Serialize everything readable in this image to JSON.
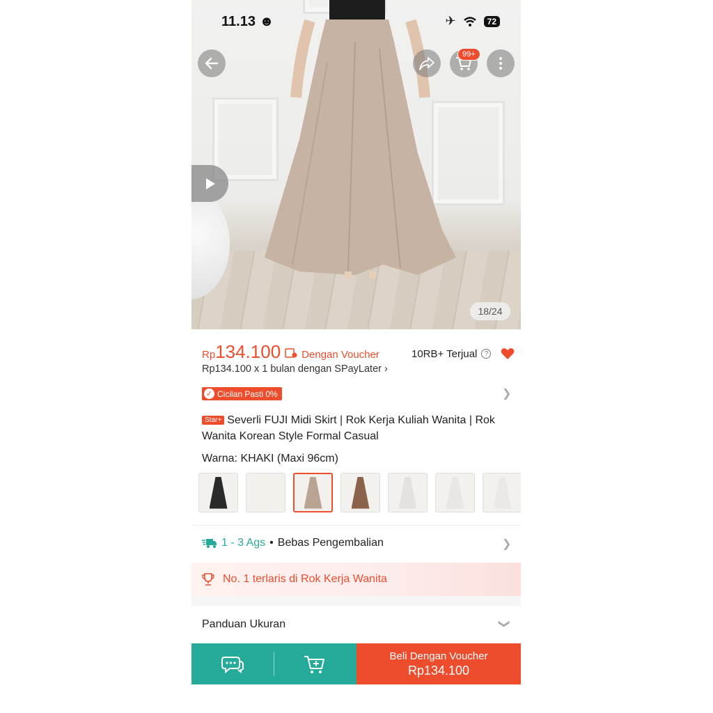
{
  "status_bar": {
    "time": "11.13",
    "battery": "72"
  },
  "gallery": {
    "counter": "18/24"
  },
  "cart": {
    "badge": "99+"
  },
  "price": {
    "currency": "Rp",
    "amount": "134.100",
    "voucher_label": "Dengan Voucher",
    "sold": "10RB+ Terjual",
    "paylater": "Rp134.100 x 1 bulan dengan SPayLater",
    "installment_badge": "Cicilan Pasti 0%"
  },
  "product": {
    "badge": "Star+",
    "title": "Severli FUJI Midi Skirt | Rok Kerja Kuliah Wanita | Rok Wanita Korean Style Formal Casual"
  },
  "variant": {
    "label": "Warna:",
    "value": "KHAKI (Maxi 96cm)",
    "swatches": [
      {
        "name": "black",
        "color": "#2a2a2a",
        "selected": false
      },
      {
        "name": "white",
        "color": "#f4f1ec",
        "selected": false
      },
      {
        "name": "khaki",
        "color": "#b9a392",
        "selected": true
      },
      {
        "name": "brown",
        "color": "#8a634a",
        "selected": false
      },
      {
        "name": "light-grey-1",
        "color": "#e4e2df",
        "selected": false
      },
      {
        "name": "light-grey-2",
        "color": "#e9e7e4",
        "selected": false
      },
      {
        "name": "light-grey-3",
        "color": "#ebe9e6",
        "selected": false
      }
    ]
  },
  "shipping": {
    "time": "1 - 3 Ags",
    "separator": "•",
    "returns": "Bebas Pengembalian"
  },
  "bestseller": {
    "text": "No. 1 terlaris di Rok Kerja Wanita"
  },
  "size_guide": {
    "label": "Panduan Ukuran"
  },
  "bottom_bar": {
    "buy_label": "Beli Dengan Voucher",
    "buy_price": "Rp134.100"
  },
  "colors": {
    "accent": "#ee4d2d",
    "teal": "#26aa99"
  }
}
